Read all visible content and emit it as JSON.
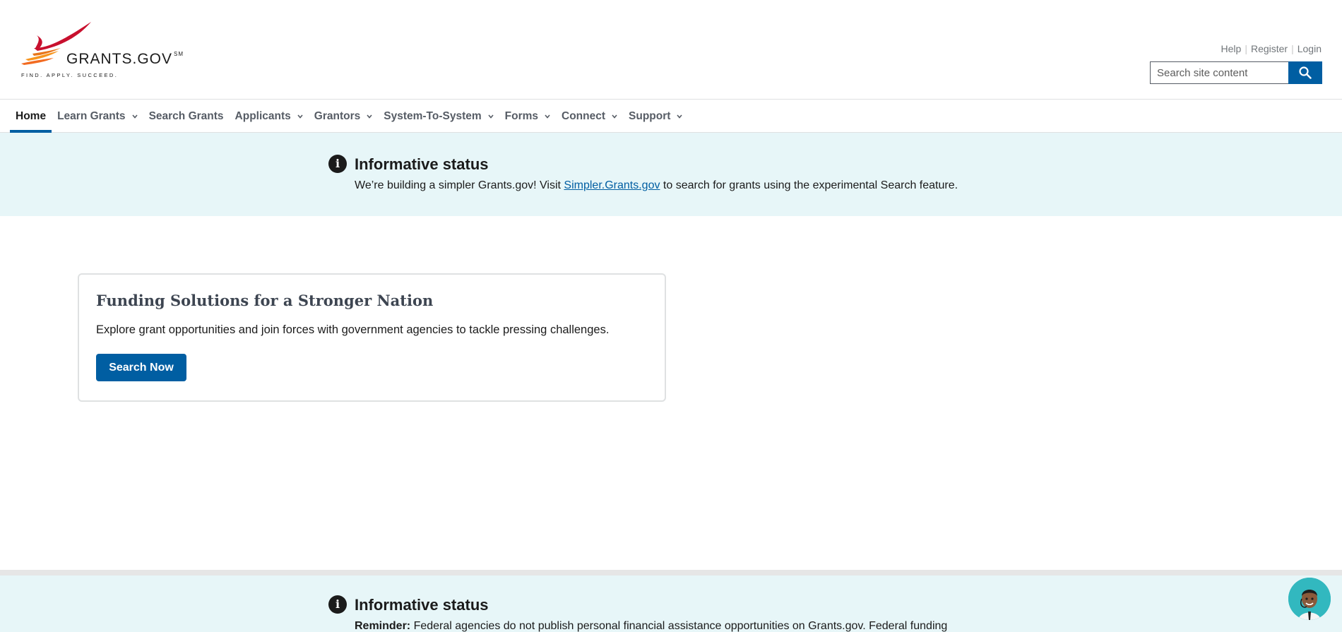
{
  "header": {
    "logo_text": "GRANTS.GOV",
    "logo_mark": "SM",
    "logo_tagline": "FIND. APPLY. SUCCEED.",
    "util_links": [
      "Help",
      "Register",
      "Login"
    ],
    "search_placeholder": "Search site content",
    "search_icon": "search-icon"
  },
  "nav": {
    "items": [
      {
        "label": "Home",
        "active": true
      },
      {
        "label": "Learn Grants",
        "dropdown": true
      },
      {
        "label": "Search Grants"
      },
      {
        "label": "Applicants",
        "dropdown": true
      },
      {
        "label": "Grantors",
        "dropdown": true
      },
      {
        "label": "System-To-System",
        "dropdown": true
      },
      {
        "label": "Forms",
        "dropdown": true
      },
      {
        "label": "Connect",
        "dropdown": true
      },
      {
        "label": "Support",
        "dropdown": true
      }
    ]
  },
  "alert_top": {
    "icon": "info-icon",
    "title": "Informative status",
    "text_before": "We’re building a simpler Grants.gov! Visit ",
    "link": "Simpler.Grants.gov",
    "text_after": " to search for grants using the experimental Search feature."
  },
  "card": {
    "title": "Funding Solutions for a Stronger Nation",
    "text": "Explore grant opportunities and join forces with government agencies to tackle pressing challenges.",
    "button": "Search Now"
  },
  "alert_bottom": {
    "icon": "info-icon",
    "title": "Informative status",
    "bold": "Reminder:",
    "text": " Federal agencies do not publish personal financial assistance opportunities on Grants.gov. Federal funding"
  },
  "chat": {
    "icon": "chat-assistant-avatar-icon"
  },
  "colors": {
    "primary": "#005ea2",
    "alert_bg": "#e7f6f8",
    "logo_red": "#c8102e",
    "logo_orange": "#f26b21"
  }
}
